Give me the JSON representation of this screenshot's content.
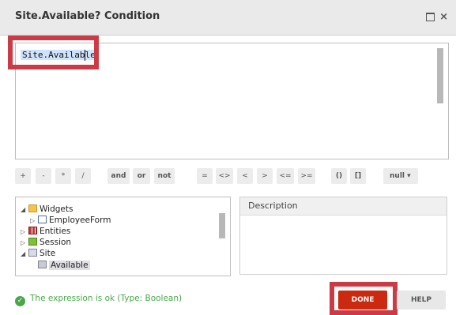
{
  "window": {
    "title": "Site.Available? Condition",
    "maximize_icon": "maximize-icon",
    "close_icon": "close-icon",
    "close_glyph": "×"
  },
  "editor": {
    "value": "Site.Available"
  },
  "operators": [
    "+",
    "-",
    "*",
    "/",
    "and",
    "or",
    "not",
    "=",
    "<>",
    "<",
    ">",
    "<=",
    ">=",
    "()",
    "[]",
    "null ▾"
  ],
  "tree": {
    "items": [
      {
        "label": "Widgets",
        "arrow": "◢",
        "icon": "folder-icon"
      },
      {
        "label": "EmployeeForm",
        "arrow": "▷",
        "icon": "form-icon"
      },
      {
        "label": "Entities",
        "arrow": "▷",
        "icon": "entities-icon"
      },
      {
        "label": "Session",
        "arrow": "▷",
        "icon": "session-icon"
      },
      {
        "label": "Site",
        "arrow": "◢",
        "icon": "site-icon"
      },
      {
        "label": "Available",
        "arrow": "",
        "icon": "variable-icon"
      }
    ]
  },
  "description": {
    "header": "Description"
  },
  "status": {
    "text": "The expression is ok (Type: Boolean)",
    "icon": "check-icon",
    "color": "#49a74a"
  },
  "buttons": {
    "done": "DONE",
    "help": "HELP"
  },
  "colors": {
    "highlight_red": "#cc3b45",
    "done_button": "#cc2a10"
  }
}
